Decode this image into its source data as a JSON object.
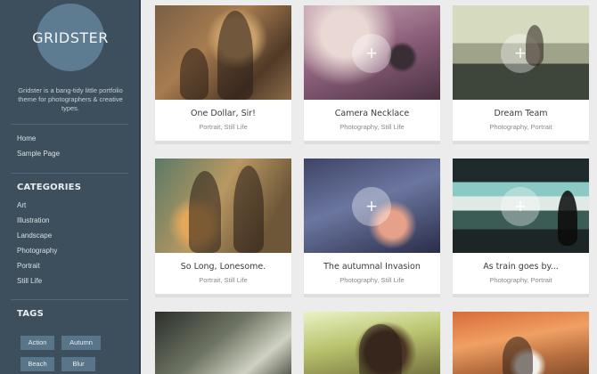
{
  "site": {
    "logo_text": "GRIDSTER",
    "tagline": "Gridster is a bang-tidy little portfolio theme for photographers & creative types."
  },
  "nav": [
    "Home",
    "Sample Page"
  ],
  "categories": {
    "title": "CATEGORIES",
    "items": [
      "Art",
      "Illustration",
      "Landscape",
      "Photography",
      "Portrait",
      "Still Life"
    ]
  },
  "tags": {
    "title": "TAGS",
    "items": [
      "Action",
      "Autumn",
      "Beach",
      "Blur"
    ]
  },
  "posts": [
    {
      "title": "One Dollar, Sir!",
      "meta": "Portrait, Still Life"
    },
    {
      "title": "Camera Necklace",
      "meta": "Photography, Still Life"
    },
    {
      "title": "Dream Team",
      "meta": "Photography, Portrait"
    },
    {
      "title": "So Long, Lonesome.",
      "meta": "Portrait, Still Life"
    },
    {
      "title": "The autumnal Invasion",
      "meta": "Photography, Still Life"
    },
    {
      "title": "As train goes by...",
      "meta": "Photography, Portrait"
    }
  ],
  "colors": {
    "sidebar": "#3d4f5c",
    "logo_circle": "#5d7b91",
    "tag_bg": "#59758a",
    "page_bg": "#ececec"
  }
}
